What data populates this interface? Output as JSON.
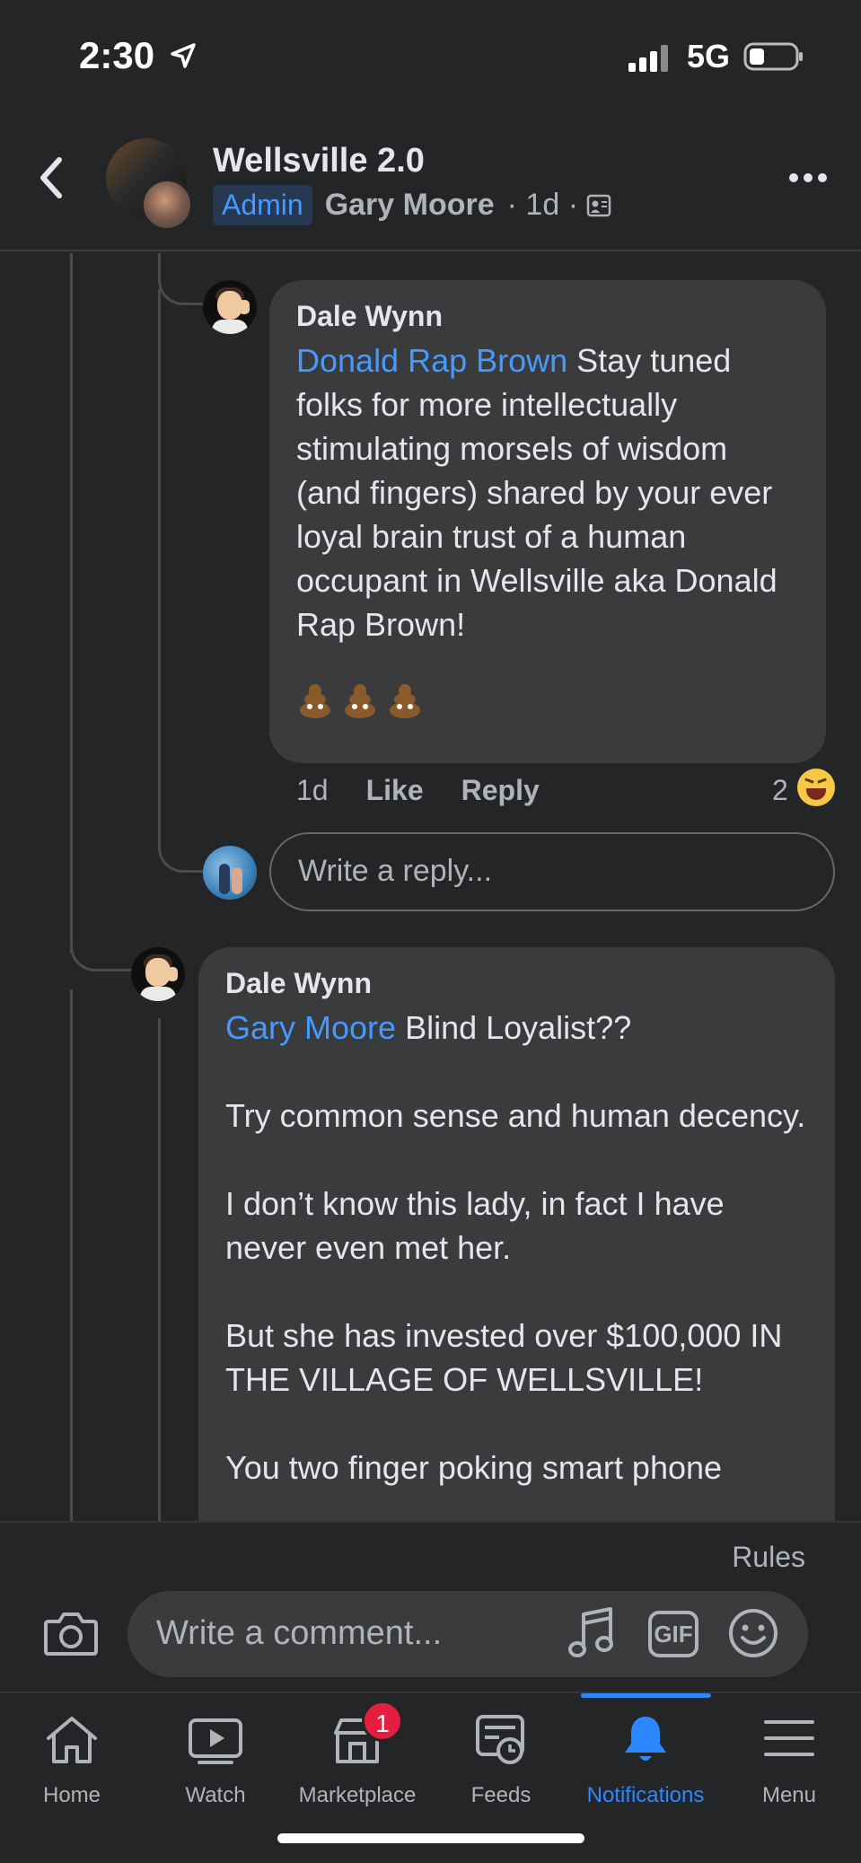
{
  "status_bar": {
    "time": "2:30",
    "network": "5G"
  },
  "header": {
    "title": "Wellsville 2.0",
    "badge": "Admin",
    "author": "Gary Moore",
    "time": "· 1d ·"
  },
  "comments": [
    {
      "author": "Dale Wynn",
      "mention": "Donald Rap Brown",
      "text": " Stay tuned folks for more intellectually stimulating morsels of wisdom (and fingers) shared by your ever loyal brain trust of a human occupant in Wellsville aka Donald Rap Brown!",
      "emoji": "💩💩💩",
      "time": "1d",
      "like_label": "Like",
      "reply_label": "Reply",
      "reaction_count": "2"
    },
    {
      "author": "Dale Wynn",
      "mention": "Gary Moore",
      "text": " Blind Loyalist??\n\nTry common sense and human decency.\n\nI don’t know this lady, in fact I have never even met her.\n\nBut she has invested over $100,000 IN THE VILLAGE OF WELLSVILLE!\n\nYou two finger poking smart phone"
    }
  ],
  "reply_input": {
    "placeholder": "Write a reply..."
  },
  "composer": {
    "rules_label": "Rules",
    "placeholder": "Write a comment...",
    "gif_label": "GIF"
  },
  "tabs": [
    {
      "label": "Home",
      "icon": "home-icon"
    },
    {
      "label": "Watch",
      "icon": "watch-icon"
    },
    {
      "label": "Marketplace",
      "icon": "marketplace-icon",
      "badge": "1"
    },
    {
      "label": "Feeds",
      "icon": "feeds-icon"
    },
    {
      "label": "Notifications",
      "icon": "bell-icon",
      "active": true
    },
    {
      "label": "Menu",
      "icon": "menu-icon"
    }
  ],
  "colors": {
    "accent": "#2d88ff",
    "mention": "#4599ff",
    "badge": "#e41e3f",
    "bubble": "#3a3b3c",
    "background": "#242526"
  }
}
